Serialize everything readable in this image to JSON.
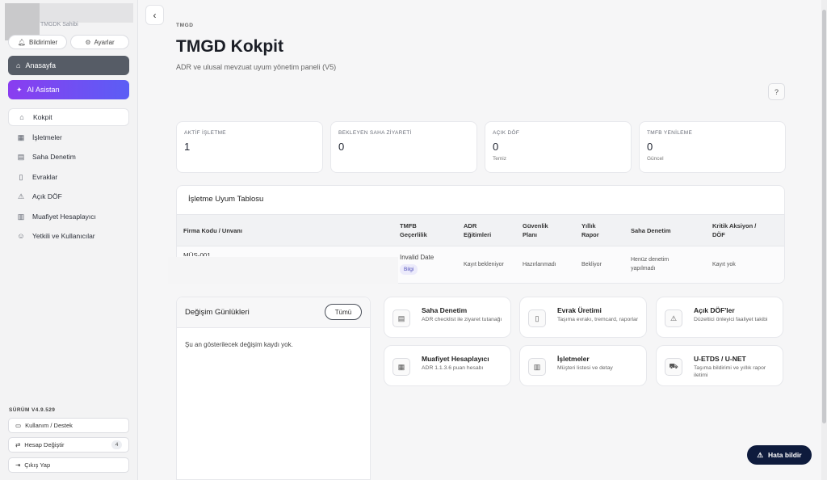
{
  "sidebar": {
    "profile_sub": "TMGDK Sahibi",
    "notifications_label": "Bildirimler",
    "settings_label": "Ayarlar",
    "home_label": "Anasayfa",
    "ai_label": "AI Asistan",
    "nav": [
      {
        "label": "Kokpit",
        "icon": "home-icon"
      },
      {
        "label": "İşletmeler",
        "icon": "building-icon"
      },
      {
        "label": "Saha Denetim",
        "icon": "clipboard-icon"
      },
      {
        "label": "Evraklar",
        "icon": "document-icon"
      },
      {
        "label": "Açık DÖF",
        "icon": "warning-icon"
      },
      {
        "label": "Muafiyet Hesaplayıcı",
        "icon": "chart-icon"
      },
      {
        "label": "Yetkili ve Kullanıcılar",
        "icon": "users-icon"
      }
    ],
    "version": "SÜRÜM V4.9.529",
    "usage_label": "Kullanım / Destek",
    "switch_label": "Hesap Değiştir",
    "switch_count": "4",
    "logout_label": "Çıkış Yap"
  },
  "header": {
    "eyebrow": "TMGD",
    "title": "TMGD Kokpit",
    "subtitle": "ADR ve ulusal mevzuat uyum yönetim paneli (V5)"
  },
  "stats": [
    {
      "label": "AKTİF İŞLETME",
      "value": "1",
      "note": ""
    },
    {
      "label": "BEKLEYEN SAHA ZİYARETİ",
      "value": "0",
      "note": ""
    },
    {
      "label": "AÇIK DÖF",
      "value": "0",
      "note": "Temiz"
    },
    {
      "label": "TMFB YENİLEME",
      "value": "0",
      "note": "Güncel"
    }
  ],
  "table": {
    "title": "İşletme Uyum Tablosu",
    "headers": {
      "firm": "Firma Kodu / Unvanı",
      "tmfb": [
        "TMFB",
        "Geçerlilik"
      ],
      "adr": [
        "ADR",
        "Eğitimleri"
      ],
      "security": [
        "Güvenlik",
        "Planı"
      ],
      "annual": [
        "Yıllık",
        "Rapor"
      ],
      "field": "Saha Denetim",
      "critical": [
        "Kritik Aksiyon /",
        "DÖF"
      ]
    },
    "row": {
      "firm": "MÜŞ-001",
      "tmfb": "Invalid Date",
      "tmfb_tag": "Bilgi",
      "adr": "Kayıt bekleniyor",
      "security": "Hazırlanmadı",
      "annual": "Bekliyor",
      "field": [
        "Henüz denetim",
        "yapılmadı"
      ],
      "critical": "Kayıt yok"
    }
  },
  "changelog": {
    "title": "Değişim Günlükleri",
    "all_label": "Tümü",
    "empty": "Şu an gösterilecek değişim kaydı yok."
  },
  "quick": [
    {
      "title": "Saha Denetim",
      "desc": "ADR checklist ile ziyaret tutanağı",
      "icon": "clipboard-icon"
    },
    {
      "title": "Evrak Üretimi",
      "desc": "Taşıma evrakı, tremcard, raporlar",
      "icon": "document-icon"
    },
    {
      "title": "Açık DÖF'ler",
      "desc": "Düzeltici önleyici faaliyet takibi",
      "icon": "warning-icon"
    },
    {
      "title": "Muafiyet Hesaplayıcı",
      "desc": "ADR 1.1.3.6 puan hesabı",
      "icon": "calculator-icon"
    },
    {
      "title": "İşletmeler",
      "desc": "Müşteri listesi ve detay",
      "icon": "building-icon"
    },
    {
      "title": "U-ETDS / U-NET",
      "desc": "Taşıma bildirimi ve yıllık rapor iletimi",
      "icon": "truck-icon"
    }
  ],
  "report_label": "Hata bildir",
  "colors": {
    "accent": "#565c66",
    "ai_start": "#8a3df0",
    "ai_end": "#5b5ef5",
    "report": "#0e1b3d"
  }
}
